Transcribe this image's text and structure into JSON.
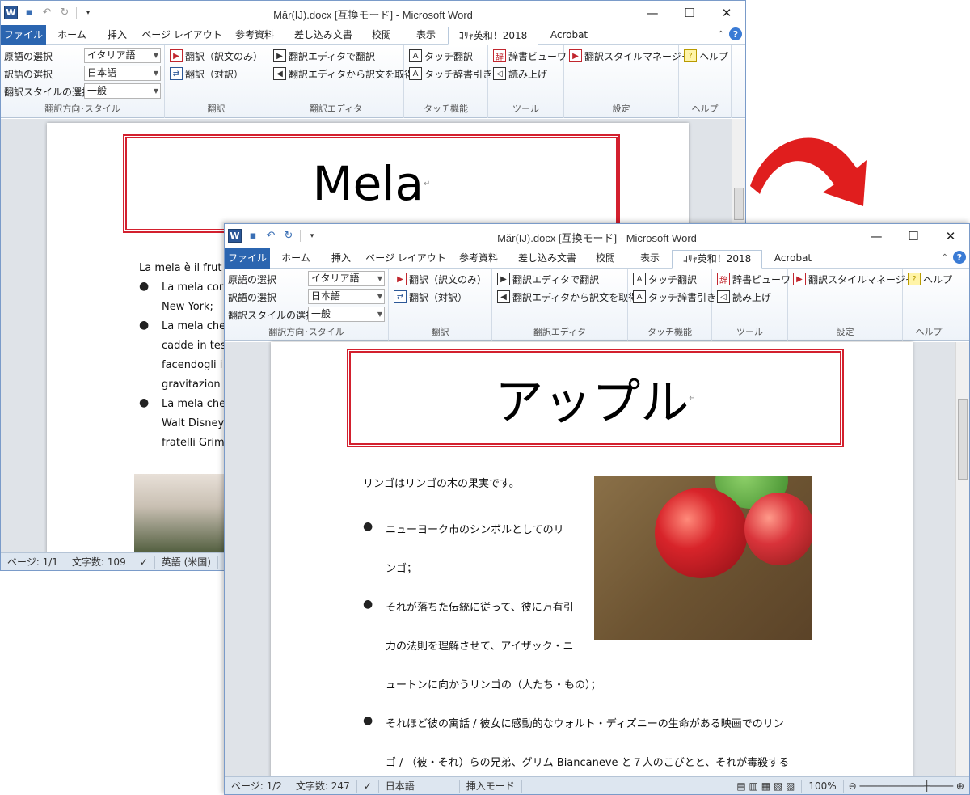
{
  "arrow_color": "#e01e1e",
  "window1": {
    "title": "Măr(IJ).docx [互換モード] - Microsoft Word",
    "tabs": [
      "ファイル",
      "ホーム",
      "挿入",
      "ページ レイアウト",
      "参考資料",
      "差し込み文書",
      "校閲",
      "表示",
      "ｺﾘｬ英和！2018",
      "Acrobat"
    ],
    "ribbon": {
      "source_label": "原語の選択",
      "source_value": "イタリア語",
      "target_label": "訳語の選択",
      "target_value": "日本語",
      "style_label": "翻訳スタイルの選択",
      "style_value": "一般",
      "group_direction": "翻訳方向･スタイル",
      "translate_only": "翻訳（訳文のみ）",
      "translate_pair": "翻訳（対訳）",
      "group_translate": "翻訳",
      "editor_translate": "翻訳エディタで翻訳",
      "editor_fetch": "翻訳エディタから訳文を取得",
      "group_editor": "翻訳エディタ",
      "touch_translate": "タッチ翻訳",
      "touch_dict": "タッチ辞書引き",
      "group_touch": "タッチ機能",
      "dict_viewer": "辞書ビューワ",
      "read_aloud": "読み上げ",
      "group_tools": "ツール",
      "style_manager": "翻訳スタイルマネージャ",
      "group_settings": "設定",
      "help": "ヘルプ",
      "group_help": "ヘルプ"
    },
    "doc": {
      "heading": "Mela",
      "intro": "La mela è il frut",
      "bullets": [
        "La mela cor",
        "New York;",
        "La mela che",
        "cadde in tes",
        "facendogli i",
        "gravitazion",
        "La mela che",
        "Walt Disney",
        "fratelli Grim"
      ]
    },
    "status": {
      "page": "ページ: 1/1",
      "words": "文字数: 109",
      "lang": "英語 (米国)"
    }
  },
  "window2": {
    "title": "Măr(IJ).docx [互換モード] - Microsoft Word",
    "tabs": [
      "ファイル",
      "ホーム",
      "挿入",
      "ページ レイアウト",
      "参考資料",
      "差し込み文書",
      "校閲",
      "表示",
      "ｺﾘｬ英和！2018",
      "Acrobat"
    ],
    "ribbon": {
      "source_label": "原語の選択",
      "source_value": "イタリア語",
      "target_label": "訳語の選択",
      "target_value": "日本語",
      "style_label": "翻訳スタイルの選択",
      "style_value": "一般",
      "group_direction": "翻訳方向･スタイル",
      "translate_only": "翻訳（訳文のみ）",
      "translate_pair": "翻訳（対訳）",
      "group_translate": "翻訳",
      "editor_translate": "翻訳エディタで翻訳",
      "editor_fetch": "翻訳エディタから訳文を取得",
      "group_editor": "翻訳エディタ",
      "touch_translate": "タッチ翻訳",
      "touch_dict": "タッチ辞書引き",
      "group_touch": "タッチ機能",
      "dict_viewer": "辞書ビューワ",
      "read_aloud": "読み上げ",
      "group_tools": "ツール",
      "style_manager": "翻訳スタイルマネージャ",
      "group_settings": "設定",
      "help": "ヘルプ",
      "group_help": "ヘルプ"
    },
    "doc": {
      "heading": "アップル",
      "intro": "リンゴはリンゴの木の果実です。",
      "b1_l1": "ニューヨーク市のシンボルとしてのリ",
      "b1_l2": "ンゴ；",
      "b2_l1": "それが落ちた伝統に従って、彼に万有引",
      "b2_l2": "力の法則を理解させて、アイザック・ニ",
      "b2_l3": "ュートンに向かうリンゴの（人たち・もの）；",
      "b3_l1": "それほど彼の寓話 / 彼女に感動的なウォルト・ディズニーの生命がある映画でのリン",
      "b3_l2": "ゴ / （彼・それ）らの兄弟、グリム Biancaneve と７人のこびとと、それが毒殺する"
    },
    "status": {
      "page": "ページ: 1/2",
      "words": "文字数: 247",
      "lang": "日本語",
      "mode": "挿入モード",
      "zoom": "100%"
    }
  }
}
